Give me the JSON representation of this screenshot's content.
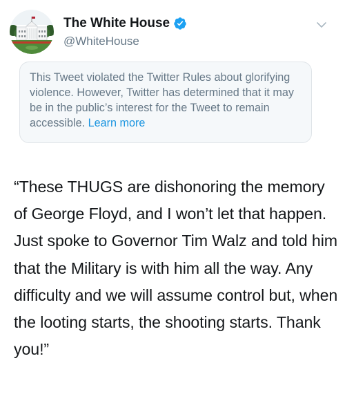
{
  "account": {
    "display_name": "The White House",
    "handle": "@WhiteHouse",
    "verified": true,
    "avatar_icon": "white-house-building"
  },
  "notice": {
    "message": "This Tweet violated the Twitter Rules about glorifying violence. However, Twitter has determined that it may be in the public’s interest for the Tweet to remain accessible.",
    "link_label": "Learn more"
  },
  "tweet": {
    "text": "“These THUGS are dishonoring the memory of George Floyd, and I won’t let that happen. Just spoke to Governor Tim Walz and told him that the Military is with him all the way. Any difficulty and we will assume control but, when the looting starts, the shooting starts. Thank you!”"
  },
  "icons": {
    "verified": "verified-badge-icon",
    "menu": "chevron-down-icon"
  },
  "colors": {
    "verified_blue": "#1da1f2",
    "link_blue": "#1b95e0",
    "secondary_text": "#657786",
    "notice_background": "#f5f8fa",
    "notice_border": "#dfe4e8",
    "primary_text": "#14171a"
  }
}
